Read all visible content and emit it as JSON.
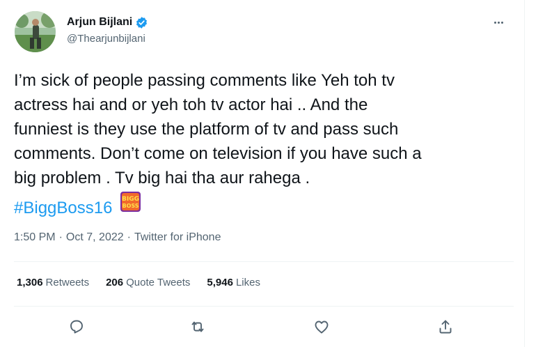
{
  "author": {
    "display_name": "Arjun Bijlani",
    "handle": "@Thearjunbijlani",
    "verified": true
  },
  "tweet": {
    "lines": [
      "I’m sick of people passing comments like Yeh toh tv",
      "actress hai and or yeh toh tv actor hai .. And the",
      "funniest is they use the platform of tv and pass such",
      "comments. Don’t come on television if you have such a",
      "big problem . Tv big hai tha aur rahega ."
    ],
    "hashtag": "#BiggBoss16",
    "hashflag_text": [
      "BIGG",
      "BOSS"
    ]
  },
  "meta": {
    "time": "1:50 PM",
    "sep1": "·",
    "date": "Oct 7, 2022",
    "sep2": "·",
    "source": "Twitter for iPhone"
  },
  "stats": {
    "retweets": {
      "count": "1,306",
      "label": "Retweets"
    },
    "quote_tweets": {
      "count": "206",
      "label": "Quote Tweets"
    },
    "likes": {
      "count": "5,946",
      "label": "Likes"
    }
  },
  "actions": [
    "reply-icon",
    "retweet-icon",
    "like-icon",
    "share-icon"
  ],
  "colors": {
    "text": "#0f1419",
    "secondary": "#536471",
    "link": "#1d9bf0",
    "border": "#eff3f4",
    "verified": "#1d9bf0"
  }
}
